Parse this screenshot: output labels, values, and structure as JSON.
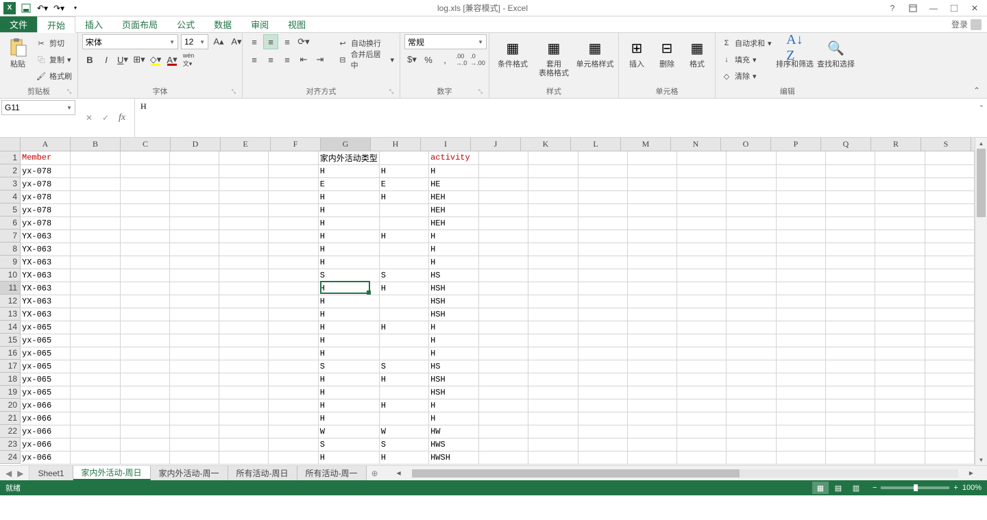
{
  "title": "log.xls [兼容模式] - Excel",
  "qat": {
    "save": "保存",
    "undo": "撤销",
    "redo": "恢复"
  },
  "tabs": {
    "file": "文件",
    "home": "开始",
    "insert": "插入",
    "layout": "页面布局",
    "formulas": "公式",
    "data": "数据",
    "review": "审阅",
    "view": "视图"
  },
  "login": "登录",
  "ribbon": {
    "clipboard": {
      "label": "剪贴板",
      "paste": "粘贴",
      "cut": "剪切",
      "copy": "复制",
      "painter": "格式刷"
    },
    "font": {
      "label": "字体",
      "name": "宋体",
      "size": "12"
    },
    "align": {
      "label": "对齐方式",
      "wrap": "自动换行",
      "merge": "合并后居中"
    },
    "number": {
      "label": "数字",
      "format": "常规"
    },
    "styles": {
      "label": "样式",
      "cond": "条件格式",
      "table": "套用\n表格格式",
      "cell": "单元格样式"
    },
    "cells": {
      "label": "单元格",
      "insert": "插入",
      "delete": "删除",
      "format": "格式"
    },
    "editing": {
      "label": "编辑",
      "sum": "自动求和",
      "fill": "填充",
      "clear": "清除",
      "sort": "排序和筛选",
      "find": "查找和选择"
    }
  },
  "namebox": "G11",
  "formula": "H",
  "columns": [
    "A",
    "B",
    "C",
    "D",
    "E",
    "F",
    "G",
    "H",
    "I",
    "J",
    "K",
    "L",
    "M",
    "N",
    "O",
    "P",
    "Q",
    "R",
    "S"
  ],
  "selected": {
    "col": "G",
    "colIndex": 6,
    "row": 11
  },
  "rows": [
    {
      "n": 1,
      "A": "Member",
      "G": "家内外活动类型",
      "I": "activity",
      "Ared": true,
      "Ired": true
    },
    {
      "n": 2,
      "A": "yx-078",
      "G": "H",
      "H": "H",
      "I": "H"
    },
    {
      "n": 3,
      "A": "yx-078",
      "G": "E",
      "H": "E",
      "I": "HE"
    },
    {
      "n": 4,
      "A": "yx-078",
      "G": "H",
      "H": "H",
      "I": "HEH"
    },
    {
      "n": 5,
      "A": "yx-078",
      "G": "H",
      "H": "",
      "I": "HEH"
    },
    {
      "n": 6,
      "A": "yx-078",
      "G": "H",
      "H": "",
      "I": "HEH"
    },
    {
      "n": 7,
      "A": "YX-063",
      "G": "H",
      "H": "H",
      "I": "H"
    },
    {
      "n": 8,
      "A": "YX-063",
      "G": "H",
      "H": "",
      "I": "H"
    },
    {
      "n": 9,
      "A": "YX-063",
      "G": "H",
      "H": "",
      "I": "H"
    },
    {
      "n": 10,
      "A": "YX-063",
      "G": "S",
      "H": "S",
      "I": "HS"
    },
    {
      "n": 11,
      "A": "YX-063",
      "G": "H",
      "H": "H",
      "I": "HSH"
    },
    {
      "n": 12,
      "A": "YX-063",
      "G": "H",
      "H": "",
      "I": "HSH"
    },
    {
      "n": 13,
      "A": "YX-063",
      "G": "H",
      "H": "",
      "I": "HSH"
    },
    {
      "n": 14,
      "A": "yx-065",
      "G": "H",
      "H": "H",
      "I": "H"
    },
    {
      "n": 15,
      "A": "yx-065",
      "G": "H",
      "H": "",
      "I": "H"
    },
    {
      "n": 16,
      "A": "yx-065",
      "G": "H",
      "H": "",
      "I": "H"
    },
    {
      "n": 17,
      "A": "yx-065",
      "G": "S",
      "H": "S",
      "I": "HS"
    },
    {
      "n": 18,
      "A": "yx-065",
      "G": "H",
      "H": "H",
      "I": "HSH"
    },
    {
      "n": 19,
      "A": "yx-065",
      "G": "H",
      "H": "",
      "I": "HSH"
    },
    {
      "n": 20,
      "A": "yx-066",
      "G": "H",
      "H": "H",
      "I": "H"
    },
    {
      "n": 21,
      "A": "yx-066",
      "G": "H",
      "H": "",
      "I": "H"
    },
    {
      "n": 22,
      "A": "yx-066",
      "G": "W",
      "H": "W",
      "I": "HW"
    },
    {
      "n": 23,
      "A": "yx-066",
      "G": "S",
      "H": "S",
      "I": "HWS"
    },
    {
      "n": 24,
      "A": "yx-066",
      "G": "H",
      "H": "H",
      "I": "HWSH"
    }
  ],
  "sheets": [
    "Sheet1",
    "家内外活动-周日",
    "家内外活动-周一",
    "所有活动-周日",
    "所有活动-周一"
  ],
  "activeSheet": 1,
  "status": "就绪",
  "zoom": "100%"
}
